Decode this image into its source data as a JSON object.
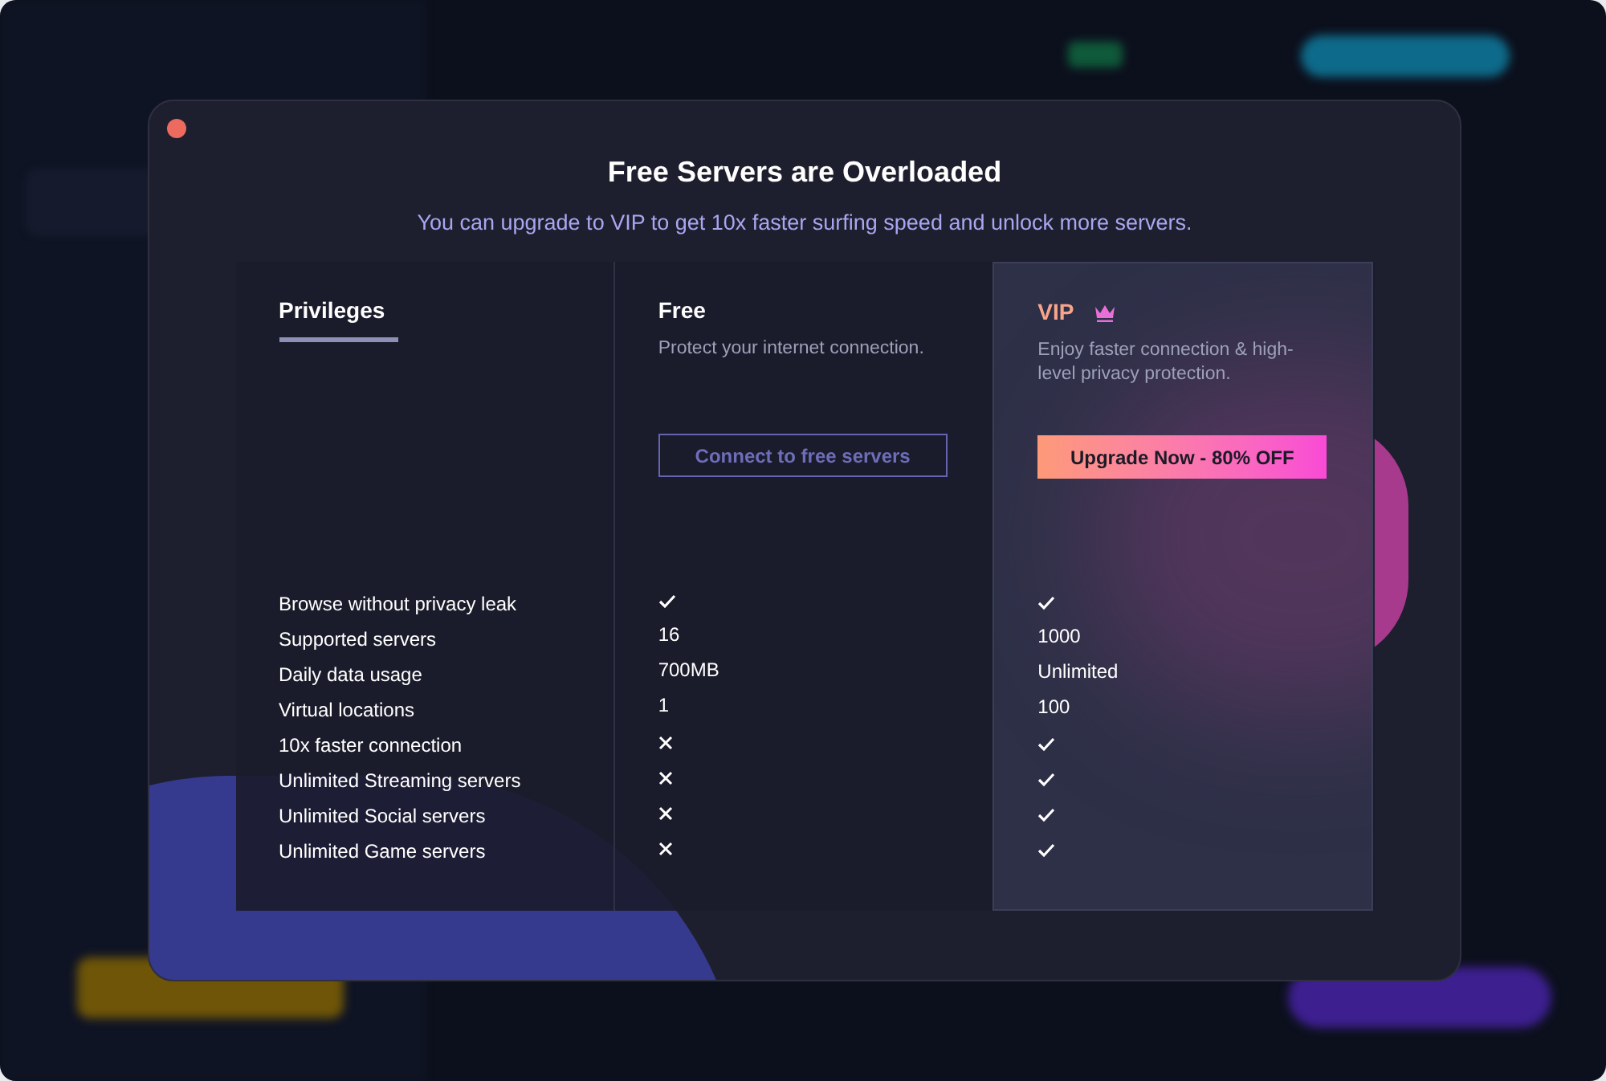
{
  "dialog": {
    "title": "Free Servers are Overloaded",
    "subtitle": "You can upgrade to VIP to get 10x faster surfing speed and unlock more servers."
  },
  "columns": [
    {
      "kind": "label",
      "title": "Privileges",
      "selected": true
    },
    {
      "kind": "plan",
      "title": "Free",
      "description": "Protect your internet connection.",
      "button": "Connect to free servers",
      "premium": false
    },
    {
      "kind": "plan",
      "title": "VIP",
      "description": "Enjoy faster connection & high-level privacy protection.",
      "button": "Upgrade Now - 80% OFF",
      "premium": true
    }
  ],
  "rows": [
    {
      "label": "Browse without privacy leak",
      "free": {
        "kind": "check"
      },
      "vip": {
        "kind": "check"
      }
    },
    {
      "label": "Supported servers",
      "free": {
        "kind": "text",
        "text": "16"
      },
      "vip": {
        "kind": "text",
        "text": "1000"
      }
    },
    {
      "label": "Daily data usage",
      "free": {
        "kind": "text",
        "text": "700MB"
      },
      "vip": {
        "kind": "text",
        "text": "Unlimited"
      }
    },
    {
      "label": "Virtual locations",
      "free": {
        "kind": "text",
        "text": "1"
      },
      "vip": {
        "kind": "text",
        "text": "100"
      }
    },
    {
      "label": "10x faster connection",
      "free": {
        "kind": "cross"
      },
      "vip": {
        "kind": "check"
      }
    },
    {
      "label": "Unlimited Streaming servers",
      "free": {
        "kind": "cross"
      },
      "vip": {
        "kind": "check"
      }
    },
    {
      "label": "Unlimited Social servers",
      "free": {
        "kind": "cross"
      },
      "vip": {
        "kind": "check"
      }
    },
    {
      "label": "Unlimited Game servers",
      "free": {
        "kind": "cross"
      },
      "vip": {
        "kind": "check"
      }
    }
  ]
}
